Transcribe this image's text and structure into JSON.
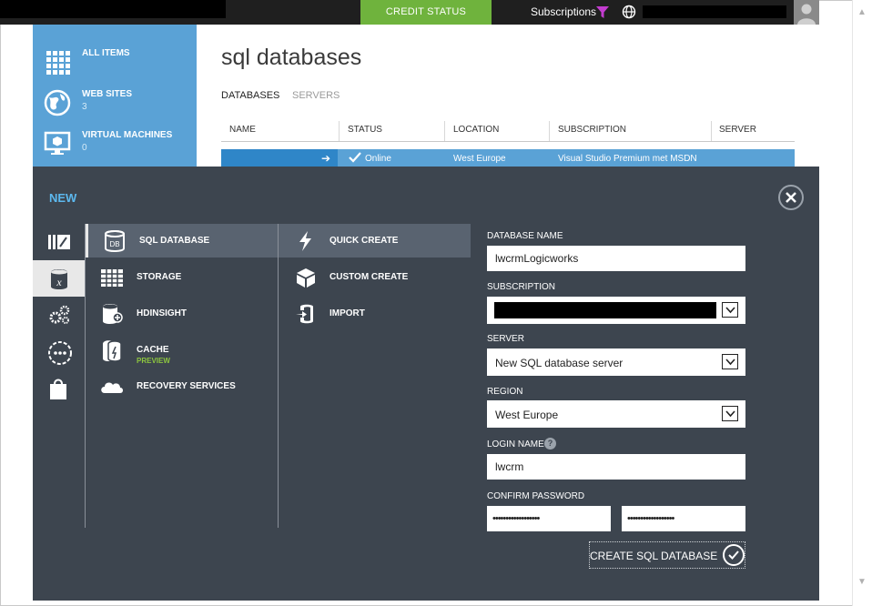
{
  "topbar": {
    "credit_status": "CREDIT STATUS",
    "subscriptions": "Subscriptions"
  },
  "portal_nav": {
    "items": [
      {
        "label": "ALL ITEMS",
        "count": "",
        "icon": "grid-icon"
      },
      {
        "label": "WEB SITES",
        "count": "3",
        "icon": "globe-icon"
      },
      {
        "label": "VIRTUAL MACHINES",
        "count": "0",
        "icon": "monitor-icon"
      }
    ]
  },
  "main": {
    "title": "sql databases",
    "tabs": [
      {
        "label": "DATABASES",
        "active": true
      },
      {
        "label": "SERVERS",
        "active": false
      }
    ],
    "columns": [
      "NAME",
      "STATUS",
      "LOCATION",
      "SUBSCRIPTION",
      "SERVER"
    ],
    "rows": [
      {
        "status": "Online",
        "location": "West Europe",
        "subscription": "Visual Studio Premium met MSDN"
      }
    ]
  },
  "drawer": {
    "title": "NEW",
    "services": [
      {
        "label": "SQL DATABASE",
        "sub": "",
        "selected": true
      },
      {
        "label": "STORAGE",
        "sub": "",
        "selected": false
      },
      {
        "label": "HDINSIGHT",
        "sub": "",
        "selected": false
      },
      {
        "label": "CACHE",
        "sub": "PREVIEW",
        "selected": false
      },
      {
        "label": "RECOVERY SERVICES",
        "sub": "",
        "selected": false
      }
    ],
    "actions": [
      {
        "label": "QUICK CREATE",
        "selected": true
      },
      {
        "label": "CUSTOM CREATE",
        "selected": false
      },
      {
        "label": "IMPORT",
        "selected": false
      }
    ],
    "form": {
      "database_name_label": "DATABASE NAME",
      "database_name_value": "lwcrmLogicworks",
      "subscription_label": "SUBSCRIPTION",
      "server_label": "SERVER",
      "server_value": "New SQL database server",
      "region_label": "REGION",
      "region_value": "West Europe",
      "login_name_label": "LOGIN NAME",
      "login_name_value": "lwcrm",
      "confirm_password_label": "CONFIRM PASSWORD",
      "password_mask": "••••••••••••••••••",
      "confirm_mask": "••••••••••••••••••",
      "create_label": "CREATE SQL DATABASE"
    }
  },
  "colors": {
    "accent_blue": "#5aa2d6",
    "credit_green": "#6fb33d",
    "drawer_bg": "#3d454f",
    "title_blue": "#5cb8ee",
    "filter_magenta": "#c33ccf"
  }
}
